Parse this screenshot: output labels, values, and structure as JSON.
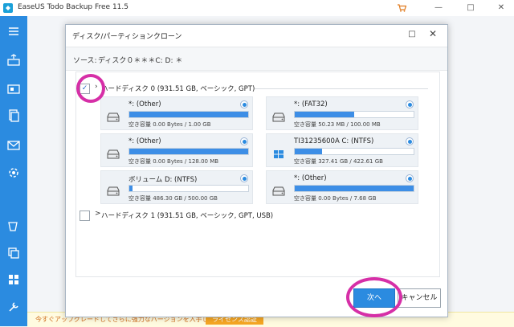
{
  "app": {
    "title": "EaseUS Todo Backup Free 11.5",
    "controls": {
      "minimize": "—",
      "restore": "□",
      "close": "✕"
    }
  },
  "sidebar": {
    "items": [
      "menu-icon",
      "backup-icon",
      "system-backup-icon",
      "file-backup-icon",
      "mail-backup-icon",
      "smart-backup-icon",
      "tools-icon",
      "clone-icon",
      "apps-icon",
      "settings-icon"
    ]
  },
  "dialog": {
    "title": "ディスク/パーティションクローン",
    "maximize": "□",
    "close": "✕",
    "source_label": "ソース:",
    "source_value": "ディスク０＊＊＊C: D: ＊",
    "disks": [
      {
        "label": "ハードディスク 0 (931.51 GB, ベーシック, GPT)",
        "checked": true,
        "check_mark": "✓",
        "arrow": "›",
        "partitions": [
          {
            "name": "*: (Other)",
            "free": "空き容量 0.00 Bytes / 1.00 GB",
            "used_fraction": 1.0,
            "icon": "drive-icon"
          },
          {
            "name": "*: (FAT32)",
            "free": "空き容量 50.23 MB / 100.00 MB",
            "used_fraction": 0.5,
            "icon": "drive-icon"
          },
          {
            "name": "*: (Other)",
            "free": "空き容量 0.00 Bytes / 128.00 MB",
            "used_fraction": 1.0,
            "icon": "drive-icon"
          },
          {
            "name": "TI31235600A C: (NTFS)",
            "free": "空き容量 327.41 GB / 422.61 GB",
            "used_fraction": 0.23,
            "icon": "windows-drive-icon"
          },
          {
            "name": "ボリューム D: (NTFS)",
            "free": "空き容量 486.30 GB / 500.00 GB",
            "used_fraction": 0.03,
            "icon": "drive-icon"
          },
          {
            "name": "*: (Other)",
            "free": "空き容量 0.00 Bytes / 7.68 GB",
            "used_fraction": 1.0,
            "icon": "drive-icon"
          }
        ]
      },
      {
        "label": "ハードディスク 1 (931.51 GB, ベーシック, GPT, USB)",
        "checked": false,
        "check_mark": "",
        "arrow": ">",
        "partitions": []
      }
    ],
    "next_button": "次へ",
    "cancel_button": "キャンセル"
  },
  "upgrade": {
    "text": "今すぐアップグレードしてさらに強力なバージョンを入手しましょう。",
    "button": "ライセンス認証"
  },
  "colors": {
    "accent": "#2b8be0",
    "highlight": "#d62fa7"
  }
}
